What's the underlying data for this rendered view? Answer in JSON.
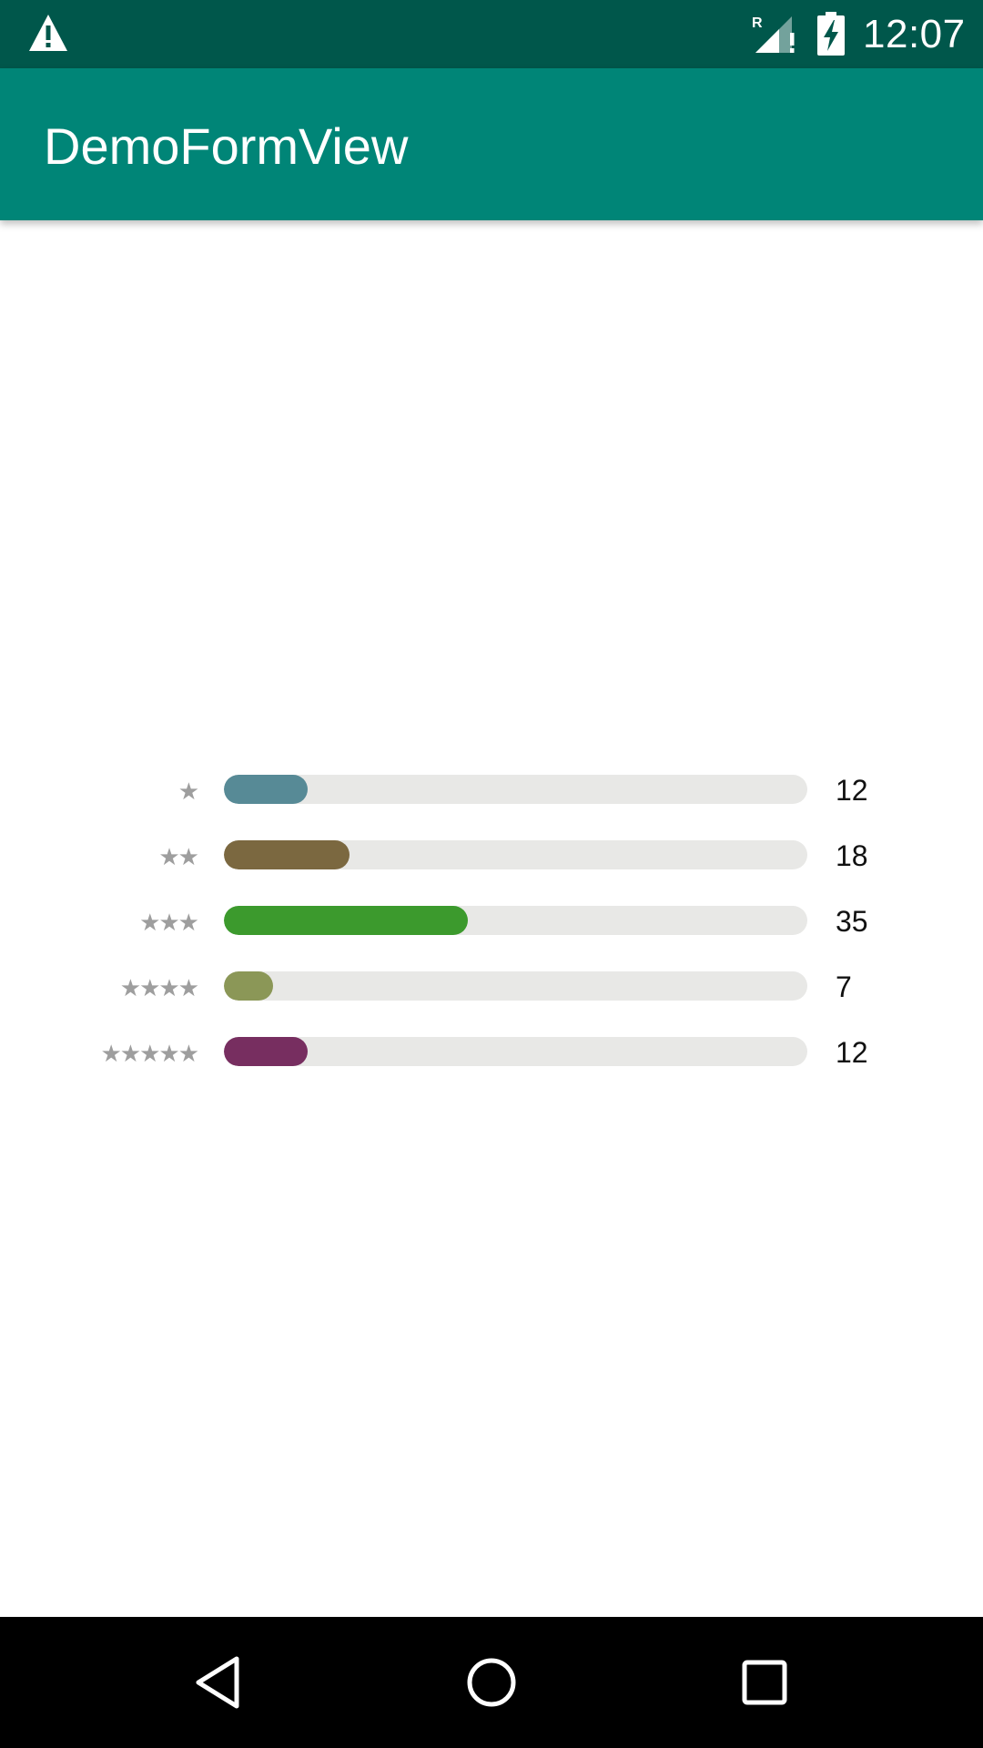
{
  "status_bar": {
    "time": "12:07",
    "roaming_indicator": "R",
    "icons": [
      "warning-icon",
      "signal-icon",
      "battery-charging-icon"
    ]
  },
  "app_bar": {
    "title": "DemoFormView",
    "color": "#008577"
  },
  "ratings": [
    {
      "stars": "★",
      "count": "12",
      "fraction": 0.143,
      "color": "#578a96"
    },
    {
      "stars": "★★",
      "count": "18",
      "fraction": 0.215,
      "color": "#7b6840"
    },
    {
      "stars": "★★★",
      "count": "35",
      "fraction": 0.418,
      "color": "#3c9a2d"
    },
    {
      "stars": "★★★★",
      "count": "7",
      "fraction": 0.084,
      "color": "#8b9757"
    },
    {
      "stars": "★★★★★",
      "count": "12",
      "fraction": 0.143,
      "color": "#772e60"
    }
  ],
  "nav_bar": {
    "buttons": [
      "back-icon",
      "home-icon",
      "recents-icon"
    ]
  }
}
